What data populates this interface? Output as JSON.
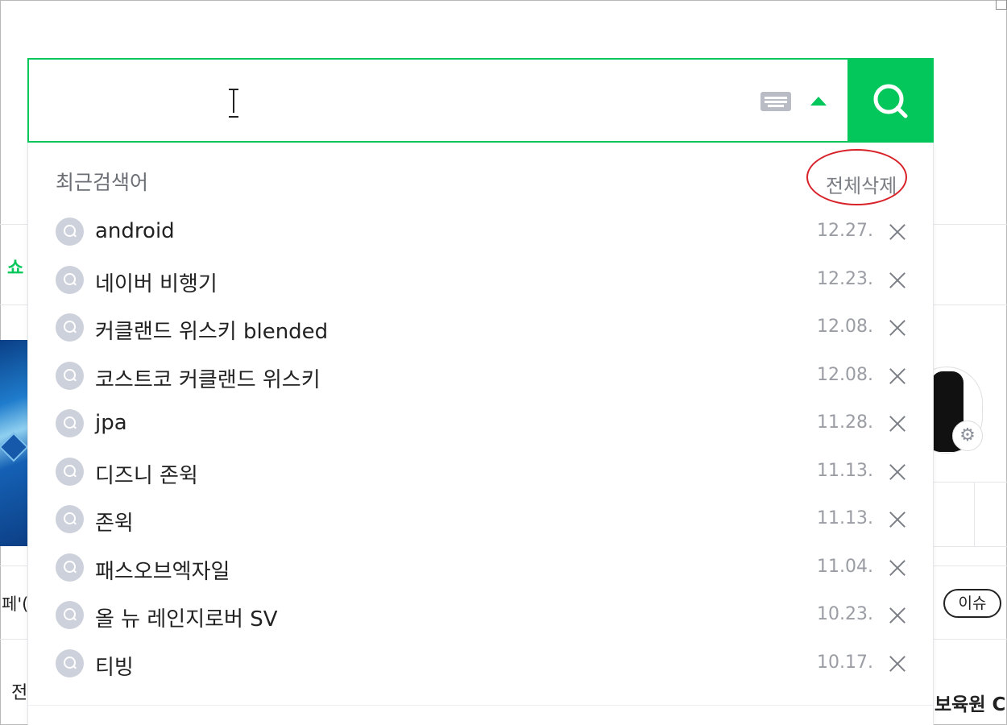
{
  "search": {
    "placeholder": "",
    "value": "",
    "keyboard_icon": "keyboard-icon",
    "toggle_icon": "arrow-up-icon",
    "button_icon": "search-icon",
    "accent_color": "#03c75a"
  },
  "recent": {
    "title": "최근검색어",
    "delete_all": "전체삭제",
    "items": [
      {
        "label": "android",
        "date": "12.27."
      },
      {
        "label": "네이버 비행기",
        "date": "12.23."
      },
      {
        "label": "커클랜드 위스키 blended",
        "date": "12.08."
      },
      {
        "label": "코스트코 커클랜드 위스키",
        "date": "12.08."
      },
      {
        "label": "jpa",
        "date": "11.28."
      },
      {
        "label": "디즈니 존윅",
        "date": "11.13."
      },
      {
        "label": "존윅",
        "date": "11.13."
      },
      {
        "label": "패스오브엑자일",
        "date": "11.04."
      },
      {
        "label": "올 뉴 레인지로버 SV",
        "date": "10.23."
      },
      {
        "label": "티빙",
        "date": "10.17."
      }
    ]
  },
  "background": {
    "issue_pill": "이슈",
    "left_green": "쇼",
    "left_fragment_1": "페'(",
    "left_fragment_2": "전",
    "right_fragment": "보육원 C",
    "right_fragment_2": "!"
  }
}
